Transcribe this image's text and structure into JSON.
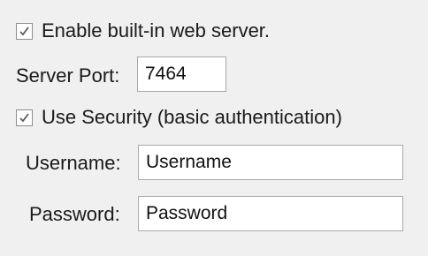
{
  "enable_server": {
    "label": "Enable built-in web server.",
    "checked": true
  },
  "port": {
    "label": "Server Port:",
    "value": "7464"
  },
  "security": {
    "label": "Use Security (basic authentication)",
    "checked": true
  },
  "username": {
    "label": "Username:",
    "placeholder": "Username"
  },
  "password": {
    "label": "Password:",
    "placeholder": "Password"
  },
  "colors": {
    "background": "#f0f0f0",
    "checkmark": "#5a5a5a",
    "field_border": "#a9a9a9"
  },
  "icons": {
    "checkbox": "check-icon"
  }
}
